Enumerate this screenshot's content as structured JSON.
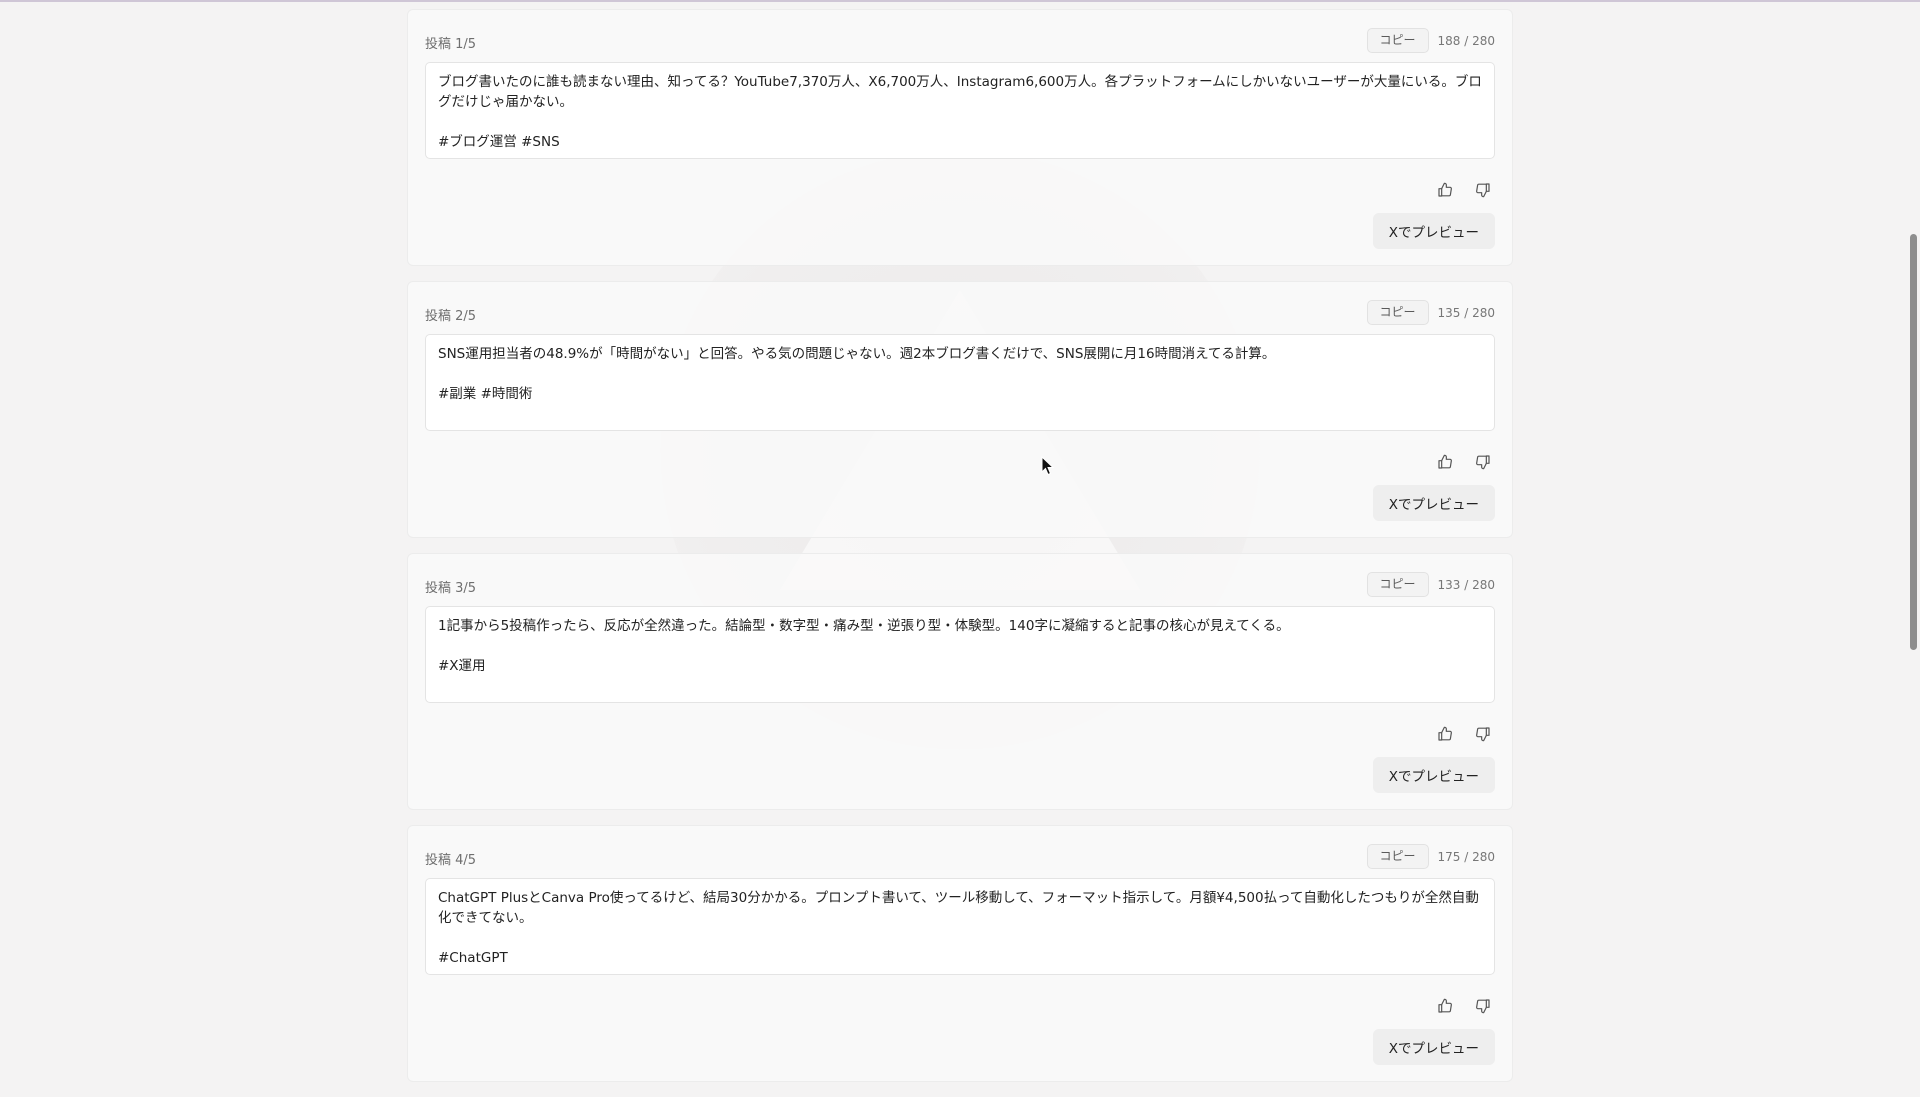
{
  "posts": [
    {
      "label": "投稿 1/5",
      "copy_label": "コピー",
      "count": "188 / 280",
      "text": "ブログ書いたのに誰も読まない理由、知ってる？YouTube7,370万人、X6,700万人、Instagram6,600万人。各プラットフォームにしかいないユーザーが大量にいる。ブログだけじゃ届かない。\n\n#ブログ運営 #SNS",
      "preview_label": "Xでプレビュー"
    },
    {
      "label": "投稿 2/5",
      "copy_label": "コピー",
      "count": "135 / 280",
      "text": "SNS運用担当者の48.9%が「時間がない」と回答。やる気の問題じゃない。週2本ブログ書くだけで、SNS展開に月16時間消えてる計算。\n\n#副業 #時間術",
      "preview_label": "Xでプレビュー"
    },
    {
      "label": "投稿 3/5",
      "copy_label": "コピー",
      "count": "133 / 280",
      "text": "1記事から5投稿作ったら、反応が全然違った。結論型・数字型・痛み型・逆張り型・体験型。140字に凝縮すると記事の核心が見えてくる。\n\n#X運用",
      "preview_label": "Xでプレビュー"
    },
    {
      "label": "投稿 4/5",
      "copy_label": "コピー",
      "count": "175 / 280",
      "text": "ChatGPT PlusとCanva Pro使ってるけど、結局30分かかる。プロンプト書いて、ツール移動して、フォーマット指示して。月額¥4,500払って自動化したつもりが全然自動化できてない。\n\n#ChatGPT",
      "preview_label": "Xでプレビュー"
    }
  ],
  "icons": {
    "like": "thumbs-up-icon",
    "dislike": "thumbs-down-icon"
  },
  "colors": {
    "background": "#f4f3f3",
    "card": "#f9f9f9",
    "textbox": "#ffffff",
    "button": "#eeeeee",
    "scroll_thumb": "#8e8e8e"
  }
}
